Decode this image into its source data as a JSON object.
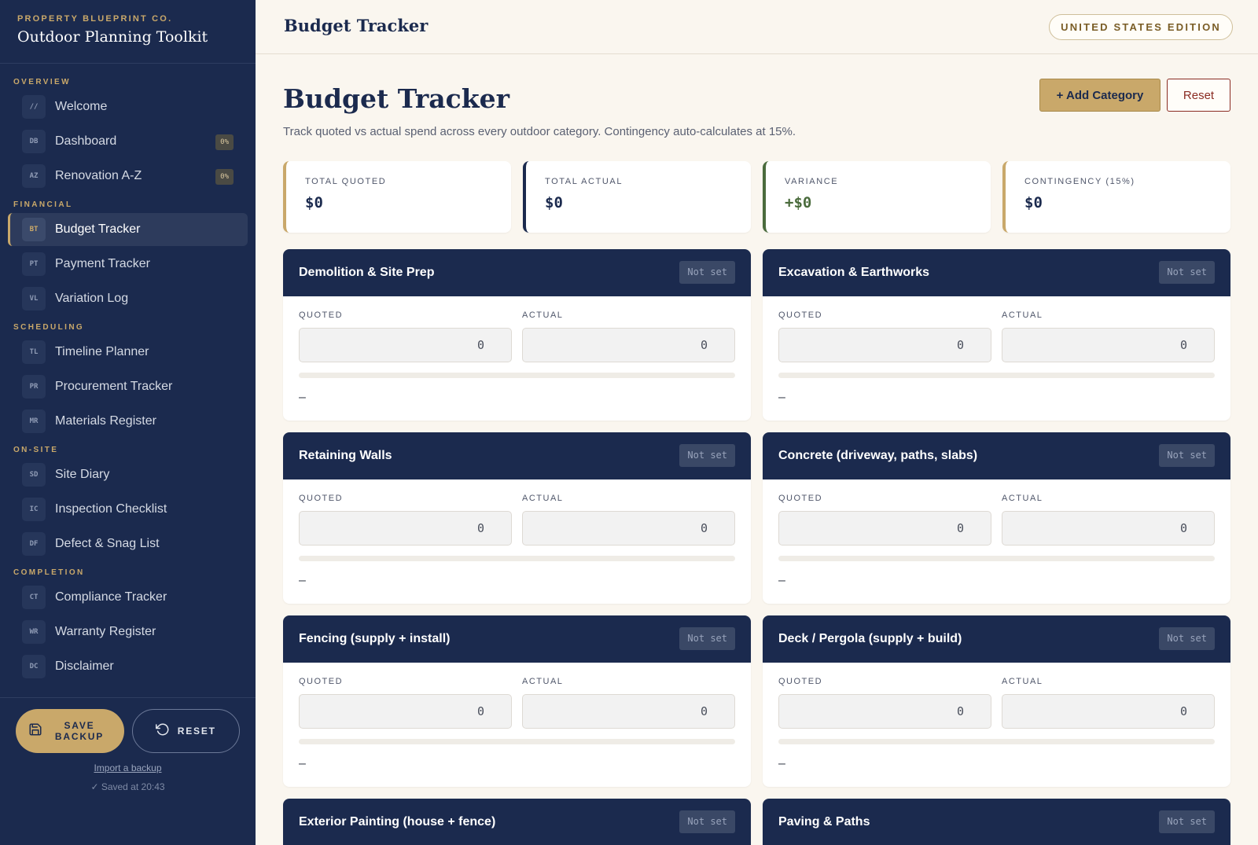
{
  "sidebar": {
    "brand_eyebrow": "PROPERTY BLUEPRINT CO.",
    "brand_title": "Outdoor Planning Toolkit",
    "sections": {
      "overview": "OVERVIEW",
      "financial": "FINANCIAL",
      "scheduling": "SCHEDULING",
      "onsite": "ON-SITE",
      "completion": "COMPLETION"
    },
    "items": [
      {
        "abbr": "//",
        "label": "Welcome"
      },
      {
        "abbr": "DB",
        "label": "Dashboard",
        "badge": "0%"
      },
      {
        "abbr": "AZ",
        "label": "Renovation A-Z",
        "badge": "0%"
      },
      {
        "abbr": "BT",
        "label": "Budget Tracker"
      },
      {
        "abbr": "PT",
        "label": "Payment Tracker"
      },
      {
        "abbr": "VL",
        "label": "Variation Log"
      },
      {
        "abbr": "TL",
        "label": "Timeline Planner"
      },
      {
        "abbr": "PR",
        "label": "Procurement Tracker"
      },
      {
        "abbr": "MR",
        "label": "Materials Register"
      },
      {
        "abbr": "SD",
        "label": "Site Diary"
      },
      {
        "abbr": "IC",
        "label": "Inspection Checklist"
      },
      {
        "abbr": "DF",
        "label": "Defect & Snag List"
      },
      {
        "abbr": "CT",
        "label": "Compliance Tracker"
      },
      {
        "abbr": "WR",
        "label": "Warranty Register"
      },
      {
        "abbr": "DC",
        "label": "Disclaimer"
      }
    ],
    "save_label_1": "SAVE",
    "save_label_2": "BACKUP",
    "reset_label": "RESET",
    "import_label": "Import a backup",
    "saved_status": "✓ Saved at 20:43"
  },
  "topbar": {
    "title": "Budget Tracker",
    "edition": "UNITED STATES EDITION"
  },
  "main": {
    "title": "Budget Tracker",
    "subtitle": "Track quoted vs actual spend across every outdoor category. Contingency auto-calculates at 15%.",
    "add_button": "+ Add Category",
    "reset_button": "Reset",
    "stats": [
      {
        "label": "TOTAL QUOTED",
        "value": "$0"
      },
      {
        "label": "TOTAL ACTUAL",
        "value": "$0"
      },
      {
        "label": "VARIANCE",
        "value": "+$0"
      },
      {
        "label": "CONTINGENCY (15%)",
        "value": "$0"
      }
    ],
    "field_labels": {
      "quoted": "QUOTED",
      "actual": "ACTUAL"
    },
    "categories": [
      {
        "name": "Demolition & Site Prep",
        "status": "Not set",
        "quoted": "0",
        "actual": "0",
        "progress": 0,
        "note": "–"
      },
      {
        "name": "Excavation & Earthworks",
        "status": "Not set",
        "quoted": "0",
        "actual": "0",
        "progress": 0,
        "note": "–"
      },
      {
        "name": "Retaining Walls",
        "status": "Not set",
        "quoted": "0",
        "actual": "0",
        "progress": 0,
        "note": "–"
      },
      {
        "name": "Concrete (driveway, paths, slabs)",
        "status": "Not set",
        "quoted": "0",
        "actual": "0",
        "progress": 0,
        "note": "–"
      },
      {
        "name": "Fencing (supply + install)",
        "status": "Not set",
        "quoted": "0",
        "actual": "0",
        "progress": 0,
        "note": "–"
      },
      {
        "name": "Deck / Pergola (supply + build)",
        "status": "Not set",
        "quoted": "0",
        "actual": "0",
        "progress": 0,
        "note": "–"
      },
      {
        "name": "Exterior Painting (house + fence)",
        "status": "Not set"
      },
      {
        "name": "Paving & Paths",
        "status": "Not set"
      }
    ]
  },
  "colors": {
    "navy": "#1b2a4e",
    "gold": "#c9a86a",
    "cream": "#faf6ef",
    "green": "#4a6b3c",
    "red": "#8a2b22"
  }
}
